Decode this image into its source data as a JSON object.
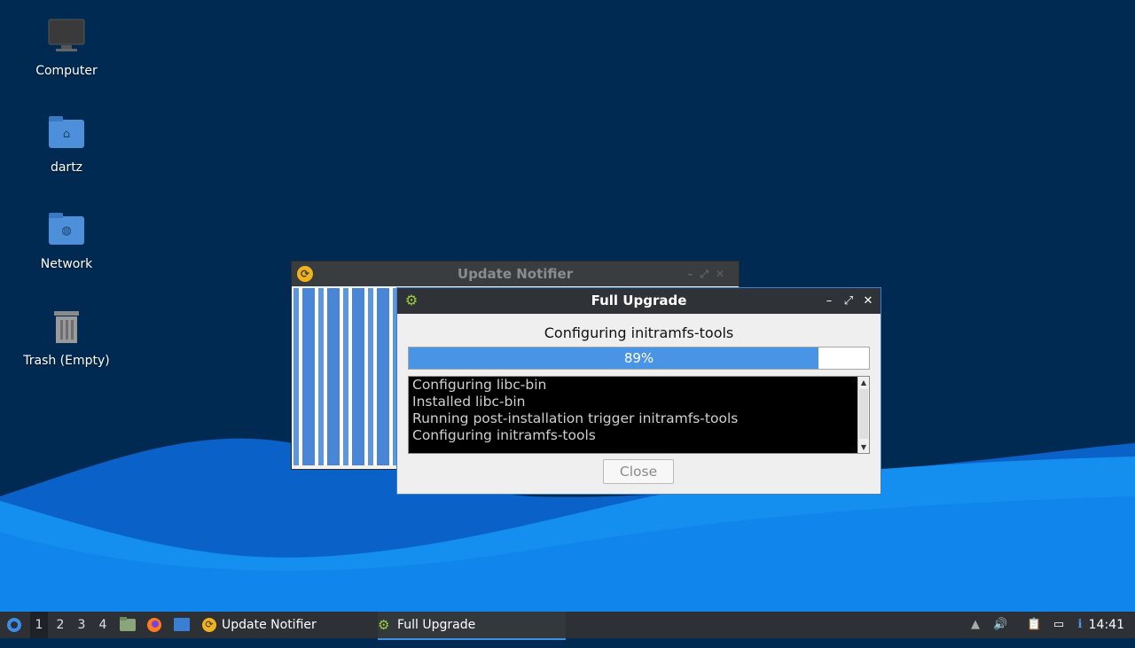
{
  "desktop": {
    "icons": [
      {
        "label": "Computer",
        "icon": "computer-icon"
      },
      {
        "label": "dartz",
        "icon": "home-folder-icon"
      },
      {
        "label": "Network",
        "icon": "network-folder-icon"
      },
      {
        "label": "Trash (Empty)",
        "icon": "trash-icon"
      }
    ]
  },
  "update_notifier": {
    "title": "Update Notifier",
    "icon": "update-notifier-icon"
  },
  "full_upgrade": {
    "title": "Full Upgrade",
    "icon": "gear-icon",
    "status": "Configuring initramfs-tools",
    "progress": {
      "percent": 89,
      "label": "89%"
    },
    "log_lines": [
      "Configuring libc-bin",
      "Installed libc-bin",
      "Running post-installation trigger initramfs-tools",
      "Configuring initramfs-tools"
    ],
    "close_label": "Close"
  },
  "taskbar": {
    "workspaces": [
      "1",
      "2",
      "3",
      "4"
    ],
    "active_workspace": "1",
    "tasks": [
      {
        "label": "Update Notifier",
        "icon": "update-notifier-icon",
        "active": false
      },
      {
        "label": "Full Upgrade",
        "icon": "gear-icon",
        "active": true
      }
    ],
    "clock": "14:41"
  },
  "colors": {
    "accent": "#4a94e6",
    "desktop_bg": "#012a52",
    "taskbar_bg": "#2d3136"
  }
}
